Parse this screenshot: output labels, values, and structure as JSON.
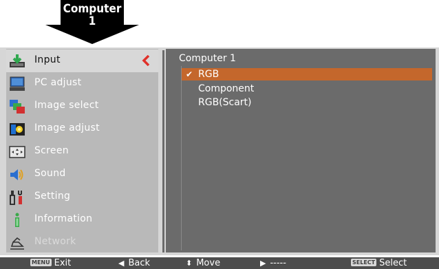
{
  "callout": {
    "line1": "Computer",
    "line2": "1"
  },
  "menu": {
    "items": [
      {
        "label": "Input",
        "icon": "input-icon",
        "state": "active"
      },
      {
        "label": "PC adjust",
        "icon": "pc-adjust-icon",
        "state": "normal"
      },
      {
        "label": "Image select",
        "icon": "image-select-icon",
        "state": "normal"
      },
      {
        "label": "Image adjust",
        "icon": "image-adjust-icon",
        "state": "normal"
      },
      {
        "label": "Screen",
        "icon": "screen-icon",
        "state": "normal"
      },
      {
        "label": "Sound",
        "icon": "sound-icon",
        "state": "normal"
      },
      {
        "label": "Setting",
        "icon": "setting-icon",
        "state": "normal"
      },
      {
        "label": "Information",
        "icon": "information-icon",
        "state": "normal"
      },
      {
        "label": "Network",
        "icon": "network-icon",
        "state": "disabled"
      }
    ]
  },
  "submenu": {
    "title": "Computer 1",
    "options": [
      {
        "label": "RGB",
        "selected": true
      },
      {
        "label": "Component",
        "selected": false
      },
      {
        "label": "RGB(Scart)",
        "selected": false
      }
    ],
    "check_glyph": "✔"
  },
  "bottom_bar": {
    "exit": {
      "key": "MENU",
      "label": "Exit"
    },
    "back": {
      "glyph": "◀",
      "label": "Back"
    },
    "move": {
      "glyph": "⬍",
      "label": "Move"
    },
    "next": {
      "glyph": "▶",
      "label": "-----"
    },
    "select": {
      "key": "SELECT",
      "label": "Select"
    }
  },
  "colors": {
    "highlight": "#c4672c",
    "chevron": "#e0312a",
    "panel_left": "#b9b9b9",
    "panel_right": "#6b6b6b"
  }
}
